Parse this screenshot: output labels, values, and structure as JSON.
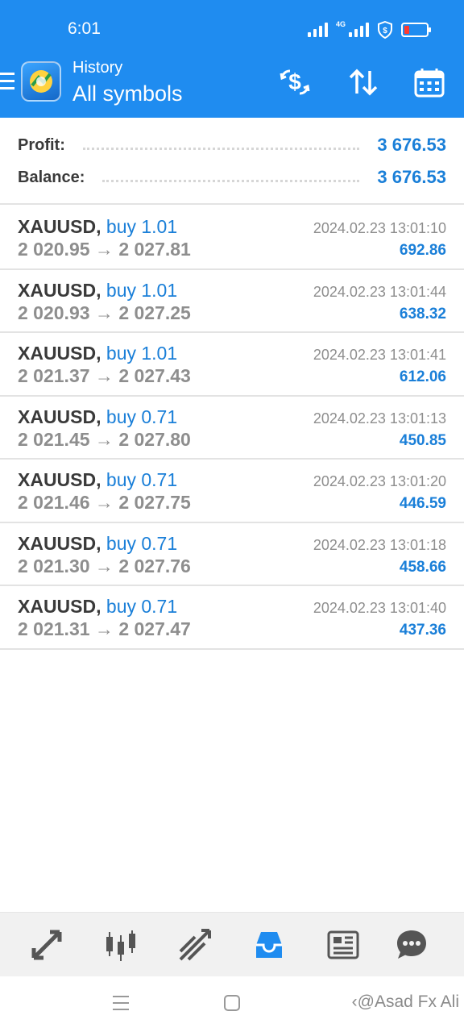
{
  "status_bar": {
    "time": "6:01",
    "network": "4G"
  },
  "header": {
    "title": "History",
    "subtitle": "All symbols"
  },
  "summary": {
    "profit_label": "Profit:",
    "profit_value": "3 676.53",
    "balance_label": "Balance:",
    "balance_value": "3 676.53"
  },
  "deals": [
    {
      "symbol": "XAUUSD,",
      "side": "buy 1.01",
      "open": "2 020.95",
      "close": "2 027.81",
      "time": "2024.02.23 13:01:10",
      "profit": "692.86"
    },
    {
      "symbol": "XAUUSD,",
      "side": "buy 1.01",
      "open": "2 020.93",
      "close": "2 027.25",
      "time": "2024.02.23 13:01:44",
      "profit": "638.32"
    },
    {
      "symbol": "XAUUSD,",
      "side": "buy 1.01",
      "open": "2 021.37",
      "close": "2 027.43",
      "time": "2024.02.23 13:01:41",
      "profit": "612.06"
    },
    {
      "symbol": "XAUUSD,",
      "side": "buy 0.71",
      "open": "2 021.45",
      "close": "2 027.80",
      "time": "2024.02.23 13:01:13",
      "profit": "450.85"
    },
    {
      "symbol": "XAUUSD,",
      "side": "buy 0.71",
      "open": "2 021.46",
      "close": "2 027.75",
      "time": "2024.02.23 13:01:20",
      "profit": "446.59"
    },
    {
      "symbol": "XAUUSD,",
      "side": "buy 0.71",
      "open": "2 021.30",
      "close": "2 027.76",
      "time": "2024.02.23 13:01:18",
      "profit": "458.66"
    },
    {
      "symbol": "XAUUSD,",
      "side": "buy 0.71",
      "open": "2 021.31",
      "close": "2 027.47",
      "time": "2024.02.23 13:01:40",
      "profit": "437.36"
    }
  ],
  "arrow": "→",
  "bottom_nav": {
    "items": [
      "quotes-icon",
      "chart-icon",
      "trade-icon",
      "history-icon",
      "news-icon",
      "chat-icon"
    ],
    "active": "history-icon"
  },
  "watermark": "@Asad Fx Ali",
  "colors": {
    "header_bg": "#1f8cf0",
    "accent": "#1a7fd8",
    "active_nav": "#1f8cf0"
  }
}
